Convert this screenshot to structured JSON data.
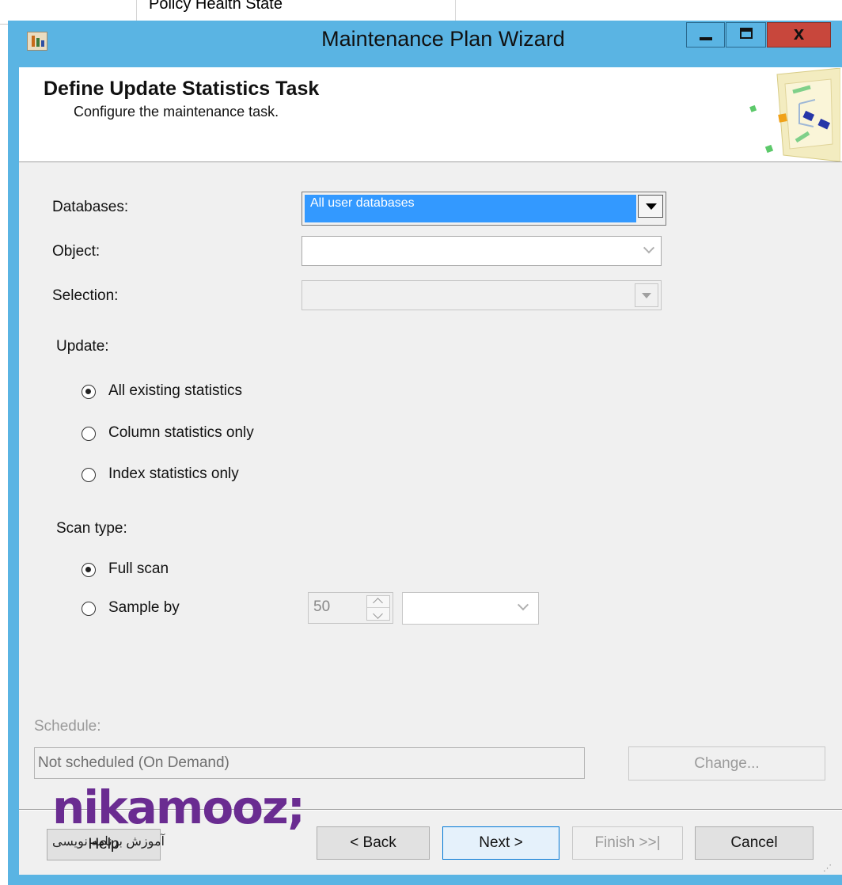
{
  "background_window": {
    "text": "Policy Health State"
  },
  "window": {
    "title": "Maintenance Plan Wizard",
    "app_icon": "maintenance-plan-icon",
    "controls": [
      "minimize",
      "maximize",
      "close"
    ],
    "close_glyph": "x",
    "title_bar_color": "#5ab4e3",
    "close_color": "#c8473c"
  },
  "header": {
    "title": "Define Update Statistics Task",
    "subtitle": "Configure the maintenance task."
  },
  "form": {
    "databases": {
      "label": "Databases:",
      "value": "All user databases"
    },
    "object": {
      "label": "Object:",
      "value": ""
    },
    "selection": {
      "label": "Selection:",
      "value": ""
    },
    "update": {
      "label": "Update:",
      "options": [
        {
          "label": "All existing statistics",
          "checked": true
        },
        {
          "label": "Column statistics only",
          "checked": false
        },
        {
          "label": "Index statistics only",
          "checked": false
        }
      ]
    },
    "scan_type": {
      "label": "Scan type:",
      "options": [
        {
          "label": "Full scan",
          "checked": true
        },
        {
          "label": "Sample by",
          "checked": false
        }
      ],
      "sample_value": "50",
      "sample_unit": ""
    }
  },
  "schedule": {
    "label": "Schedule:",
    "value": "Not scheduled (On Demand)",
    "change_label": "Change..."
  },
  "buttons": {
    "help": "Help",
    "back": "< Back",
    "next": "Next >",
    "finish": "Finish >>|",
    "cancel": "Cancel"
  },
  "watermark": {
    "logo": "nikamooz;",
    "subtitle": "آموزش برنامه نویسی"
  },
  "colors": {
    "selection_highlight": "#3399ff",
    "watermark": "#6a2c91"
  }
}
